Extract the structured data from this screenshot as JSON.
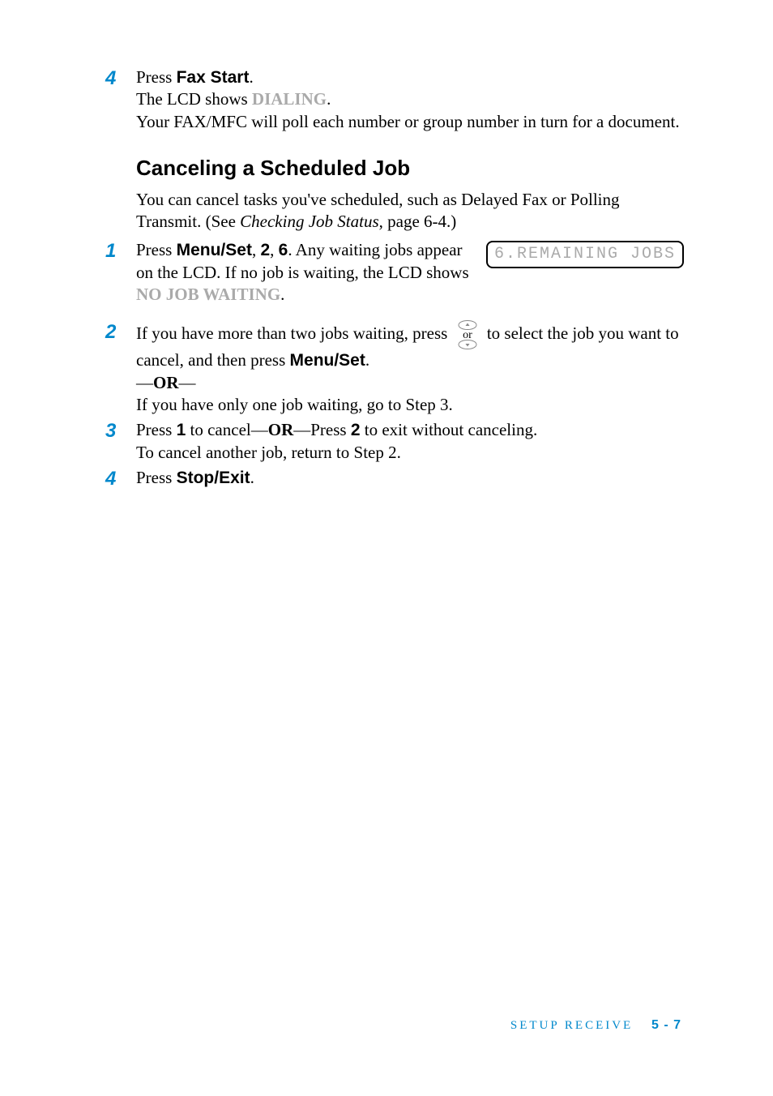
{
  "step4a": {
    "num": "4",
    "line1_pre": "Press ",
    "line1_bold": "Fax Start",
    "line1_post": ".",
    "line2_pre": "The LCD shows ",
    "line2_lcd": "DIALING",
    "line2_post": ".",
    "line3": "Your FAX/MFC will poll each number or group number in turn for a document."
  },
  "heading": "Canceling a Scheduled Job",
  "intro": {
    "line1": "You can cancel tasks you've scheduled, such as Delayed Fax or Polling Transmit. (See ",
    "italic": "Checking Job Status",
    "post": ", page 6-4.)"
  },
  "lcd_display": "6.REMAINING JOBS",
  "step1": {
    "num": "1",
    "pre": "Press ",
    "b1": "Menu/Set",
    "sep1": ", ",
    "b2": "2",
    "sep2": ", ",
    "b3": "6",
    "post1": ". Any waiting jobs appear on the LCD. If no job is waiting, the LCD shows ",
    "lcd": "NO JOB WAITING",
    "post2": "."
  },
  "step2": {
    "num": "2",
    "line1_pre": "If you have more than two jobs waiting, press ",
    "line1_post": " to select the job you want to cancel, and then press ",
    "line1_bold": "Menu/Set",
    "line1_end": ".",
    "or_pre": "—",
    "or": "OR",
    "or_post": "—",
    "line2": "If you have only one job waiting, go to Step 3."
  },
  "step3": {
    "num": "3",
    "pre": "Press ",
    "b1": "1",
    "mid1": " to cancel—",
    "or": "OR",
    "mid2": "—Press ",
    "b2": "2",
    "post": " to exit without canceling.",
    "line2": "To cancel another job, return to Step 2."
  },
  "step4b": {
    "num": "4",
    "pre": "Press ",
    "bold": "Stop/Exit",
    "post": "."
  },
  "footer": {
    "section": "SETUP RECEIVE",
    "page": "5 - 7"
  }
}
